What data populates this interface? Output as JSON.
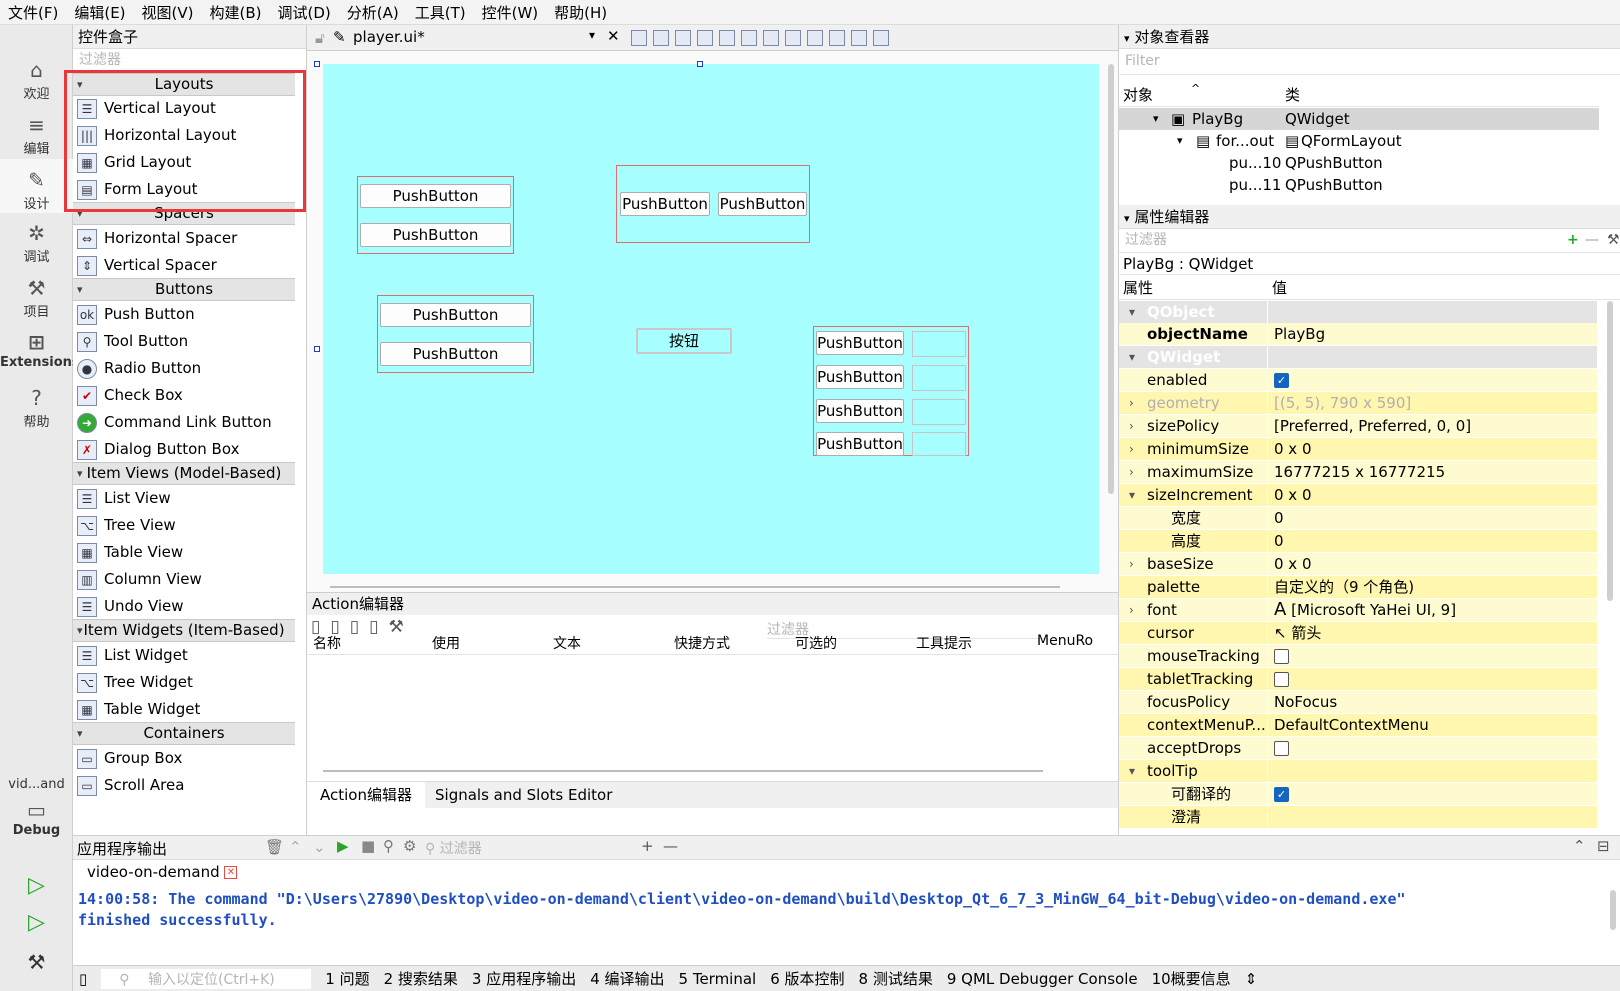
{
  "menu": [
    "文件(F)",
    "编辑(E)",
    "视图(V)",
    "构建(B)",
    "调试(D)",
    "分析(A)",
    "工具(T)",
    "控件(W)",
    "帮助(H)"
  ],
  "modes": [
    {
      "label": "欢迎",
      "icon": "home-icon"
    },
    {
      "label": "编辑",
      "icon": "edit-icon"
    },
    {
      "label": "设计",
      "icon": "design-icon"
    },
    {
      "label": "调试",
      "icon": "debug-bug-icon"
    },
    {
      "label": "项目",
      "icon": "wrench-icon"
    },
    {
      "label": "Extensions",
      "icon": "extensions-icon"
    },
    {
      "label": "帮助",
      "icon": "help-icon"
    }
  ],
  "kit": {
    "project": "vid...and",
    "config": "Debug"
  },
  "widgetbox": {
    "title": "控件盒子",
    "filter_placeholder": "过滤器",
    "categories": {
      "layouts": "Layouts",
      "spacers": "Spacers",
      "buttons": "Buttons",
      "item_views": "Item Views (Model-Based)",
      "item_widgets": "Item Widgets (Item-Based)",
      "containers": "Containers"
    },
    "items": {
      "vertical_layout": "Vertical Layout",
      "horizontal_layout": "Horizontal Layout",
      "grid_layout": "Grid Layout",
      "form_layout": "Form Layout",
      "horizontal_spacer": "Horizontal Spacer",
      "vertical_spacer": "Vertical Spacer",
      "push_button": "Push Button",
      "tool_button": "Tool Button",
      "radio_button": "Radio Button",
      "check_box": "Check Box",
      "command_link_button": "Command Link Button",
      "dialog_button_box": "Dialog Button Box",
      "list_view": "List View",
      "tree_view": "Tree View",
      "table_view": "Table View",
      "column_view": "Column View",
      "undo_view": "Undo View",
      "list_widget": "List Widget",
      "tree_widget": "Tree Widget",
      "table_widget": "Table Widget",
      "group_box": "Group Box",
      "scroll_area": "Scroll Area"
    }
  },
  "editor": {
    "file": "player.ui*",
    "push_button": "PushButton",
    "button_cn": "按钮"
  },
  "action_editor": {
    "title": "Action编辑器",
    "filter_placeholder": "过滤器",
    "columns": [
      "名称",
      "使用",
      "文本",
      "快捷方式",
      "可选的",
      "工具提示",
      "MenuRo"
    ],
    "tabs": [
      "Action编辑器",
      "Signals and Slots Editor"
    ]
  },
  "object_inspector": {
    "title": "对象查看器",
    "filter_placeholder": "Filter",
    "col_object": "对象",
    "col_class": "类",
    "rows": [
      {
        "name": "PlayBg",
        "cls": "QWidget"
      },
      {
        "name": "for...out",
        "cls": "QFormLayout"
      },
      {
        "name": "pu...10",
        "cls": "QPushButton"
      },
      {
        "name": "pu...11",
        "cls": "QPushButton"
      }
    ]
  },
  "property_editor": {
    "title": "属性编辑器",
    "filter_placeholder": "过滤器",
    "context": "PlayBg : QWidget",
    "col_prop": "属性",
    "col_value": "值",
    "rows": [
      {
        "n": "QObject",
        "v": ""
      },
      {
        "n": "objectName",
        "v": "PlayBg"
      },
      {
        "n": "QWidget",
        "v": ""
      },
      {
        "n": "enabled",
        "v": ""
      },
      {
        "n": "geometry",
        "v": "[(5, 5), 790 x 590]"
      },
      {
        "n": "sizePolicy",
        "v": "[Preferred, Preferred, 0, 0]"
      },
      {
        "n": "minimumSize",
        "v": "0 x 0"
      },
      {
        "n": "maximumSize",
        "v": "16777215 x 16777215"
      },
      {
        "n": "sizeIncrement",
        "v": "0 x 0"
      },
      {
        "n": "宽度",
        "v": "0"
      },
      {
        "n": "高度",
        "v": "0"
      },
      {
        "n": "baseSize",
        "v": "0 x 0"
      },
      {
        "n": "palette",
        "v": "自定义的（9 个角色)"
      },
      {
        "n": "font",
        "v": "[Microsoft YaHei UI, 9]"
      },
      {
        "n": "cursor",
        "v": "箭头"
      },
      {
        "n": "mouseTracking",
        "v": ""
      },
      {
        "n": "tabletTracking",
        "v": ""
      },
      {
        "n": "focusPolicy",
        "v": "NoFocus"
      },
      {
        "n": "contextMenuP...",
        "v": "DefaultContextMenu"
      },
      {
        "n": "acceptDrops",
        "v": ""
      },
      {
        "n": "toolTip",
        "v": ""
      },
      {
        "n": "可翻译的",
        "v": ""
      },
      {
        "n": "澄清",
        "v": ""
      }
    ]
  },
  "output": {
    "title": "应用程序输出",
    "filter_placeholder": "过滤器",
    "tab": "video-on-demand",
    "line1": "14:00:58: The command \"D:\\Users\\27890\\Desktop\\video-on-demand\\client\\video-on-demand\\build\\Desktop_Qt_6_7_3_MinGW_64_bit-Debug\\video-on-demand.exe\"",
    "line2": "finished successfully."
  },
  "statusbar": {
    "locator_placeholder": "输入以定位(Ctrl+K)",
    "items": [
      "1 问题",
      "2 搜索结果",
      "3 应用程序输出",
      "4 编译输出",
      "5 Terminal",
      "6 版本控制",
      "8 测试结果",
      "9 QML Debugger Console",
      "10概要信息"
    ]
  },
  "colors": {
    "canvas": "#a8ffff",
    "property_bg": "#fffbd0",
    "highlight": "#e8383a",
    "output_text": "#1f4fc0"
  }
}
